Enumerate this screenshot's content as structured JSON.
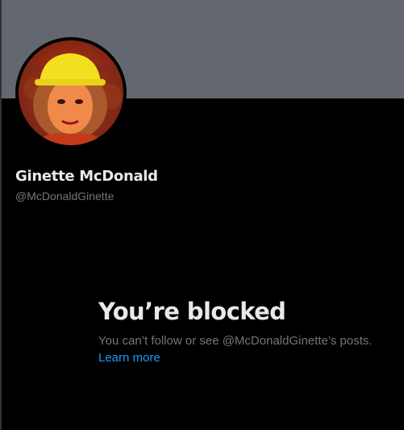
{
  "profile": {
    "display_name": "Ginette McDonald",
    "handle": "@McDonaldGinette",
    "avatar_icon": "profile-photo"
  },
  "blocked": {
    "title": "You’re blocked",
    "description": "You can’t follow or see @McDonaldGinette’s posts.",
    "learn_more": "Learn more"
  },
  "colors": {
    "background": "#000000",
    "banner": "#636770",
    "primary_text": "#e7e9ea",
    "secondary_text": "#71767b",
    "link": "#1d9bf0"
  }
}
